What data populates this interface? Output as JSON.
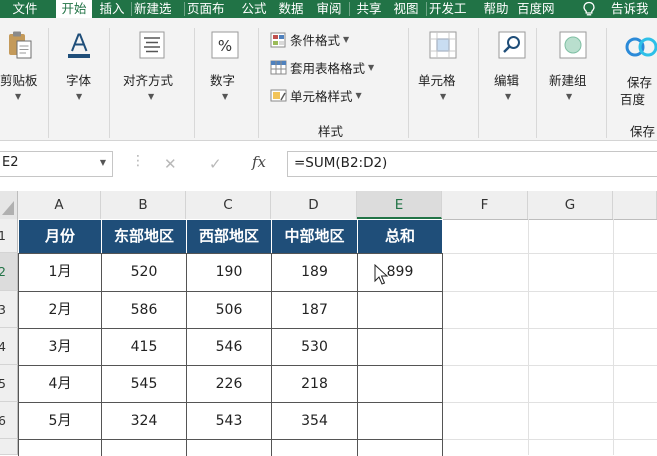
{
  "tabs": [
    {
      "label": "文件",
      "active": false
    },
    {
      "label": "开始",
      "active": true
    },
    {
      "label": "插入",
      "active": false
    },
    {
      "label": "新建选",
      "active": false
    },
    {
      "label": "页面布",
      "active": false
    },
    {
      "label": "公式",
      "active": false
    },
    {
      "label": "数据",
      "active": false
    },
    {
      "label": "审阅",
      "active": false
    },
    {
      "label": "共享",
      "active": false
    },
    {
      "label": "视图",
      "active": false
    },
    {
      "label": "开发工",
      "active": false
    },
    {
      "label": "帮助",
      "active": false
    },
    {
      "label": "百度网",
      "active": false
    }
  ],
  "tell_me": "告诉我",
  "ribbon": {
    "clipboard": "剪贴板",
    "font": "字体",
    "alignment": "对齐方式",
    "number": "数字",
    "conditional_formatting": "条件格式",
    "format_as_table": "套用表格格式",
    "cell_styles": "单元格样式",
    "styles_group": "样式",
    "cells": "单元格",
    "editing": "编辑",
    "new_group": "新建组",
    "save_line1": "保存",
    "save_line2": "百度",
    "save_group": "保存"
  },
  "formula_bar": {
    "name_box": "E2",
    "cancel_symbol": "✕",
    "enter_symbol": "✓",
    "fx": "fx",
    "formula": "=SUM(B2:D2)"
  },
  "columns": [
    "A",
    "B",
    "C",
    "D",
    "E",
    "F",
    "G"
  ],
  "rows": [
    "1",
    "2",
    "3",
    "4",
    "5",
    "6"
  ],
  "table": {
    "headers": [
      "月份",
      "东部地区",
      "西部地区",
      "中部地区",
      "总和"
    ],
    "rows": [
      [
        "1月",
        "520",
        "190",
        "189",
        "899"
      ],
      [
        "2月",
        "586",
        "506",
        "187",
        ""
      ],
      [
        "3月",
        "415",
        "546",
        "530",
        ""
      ],
      [
        "4月",
        "545",
        "226",
        "218",
        ""
      ],
      [
        "5月",
        "324",
        "543",
        "354",
        ""
      ]
    ]
  },
  "colors": {
    "excel_green": "#217346",
    "header_fill": "#1f4e79",
    "header_text": "#ffffff"
  }
}
